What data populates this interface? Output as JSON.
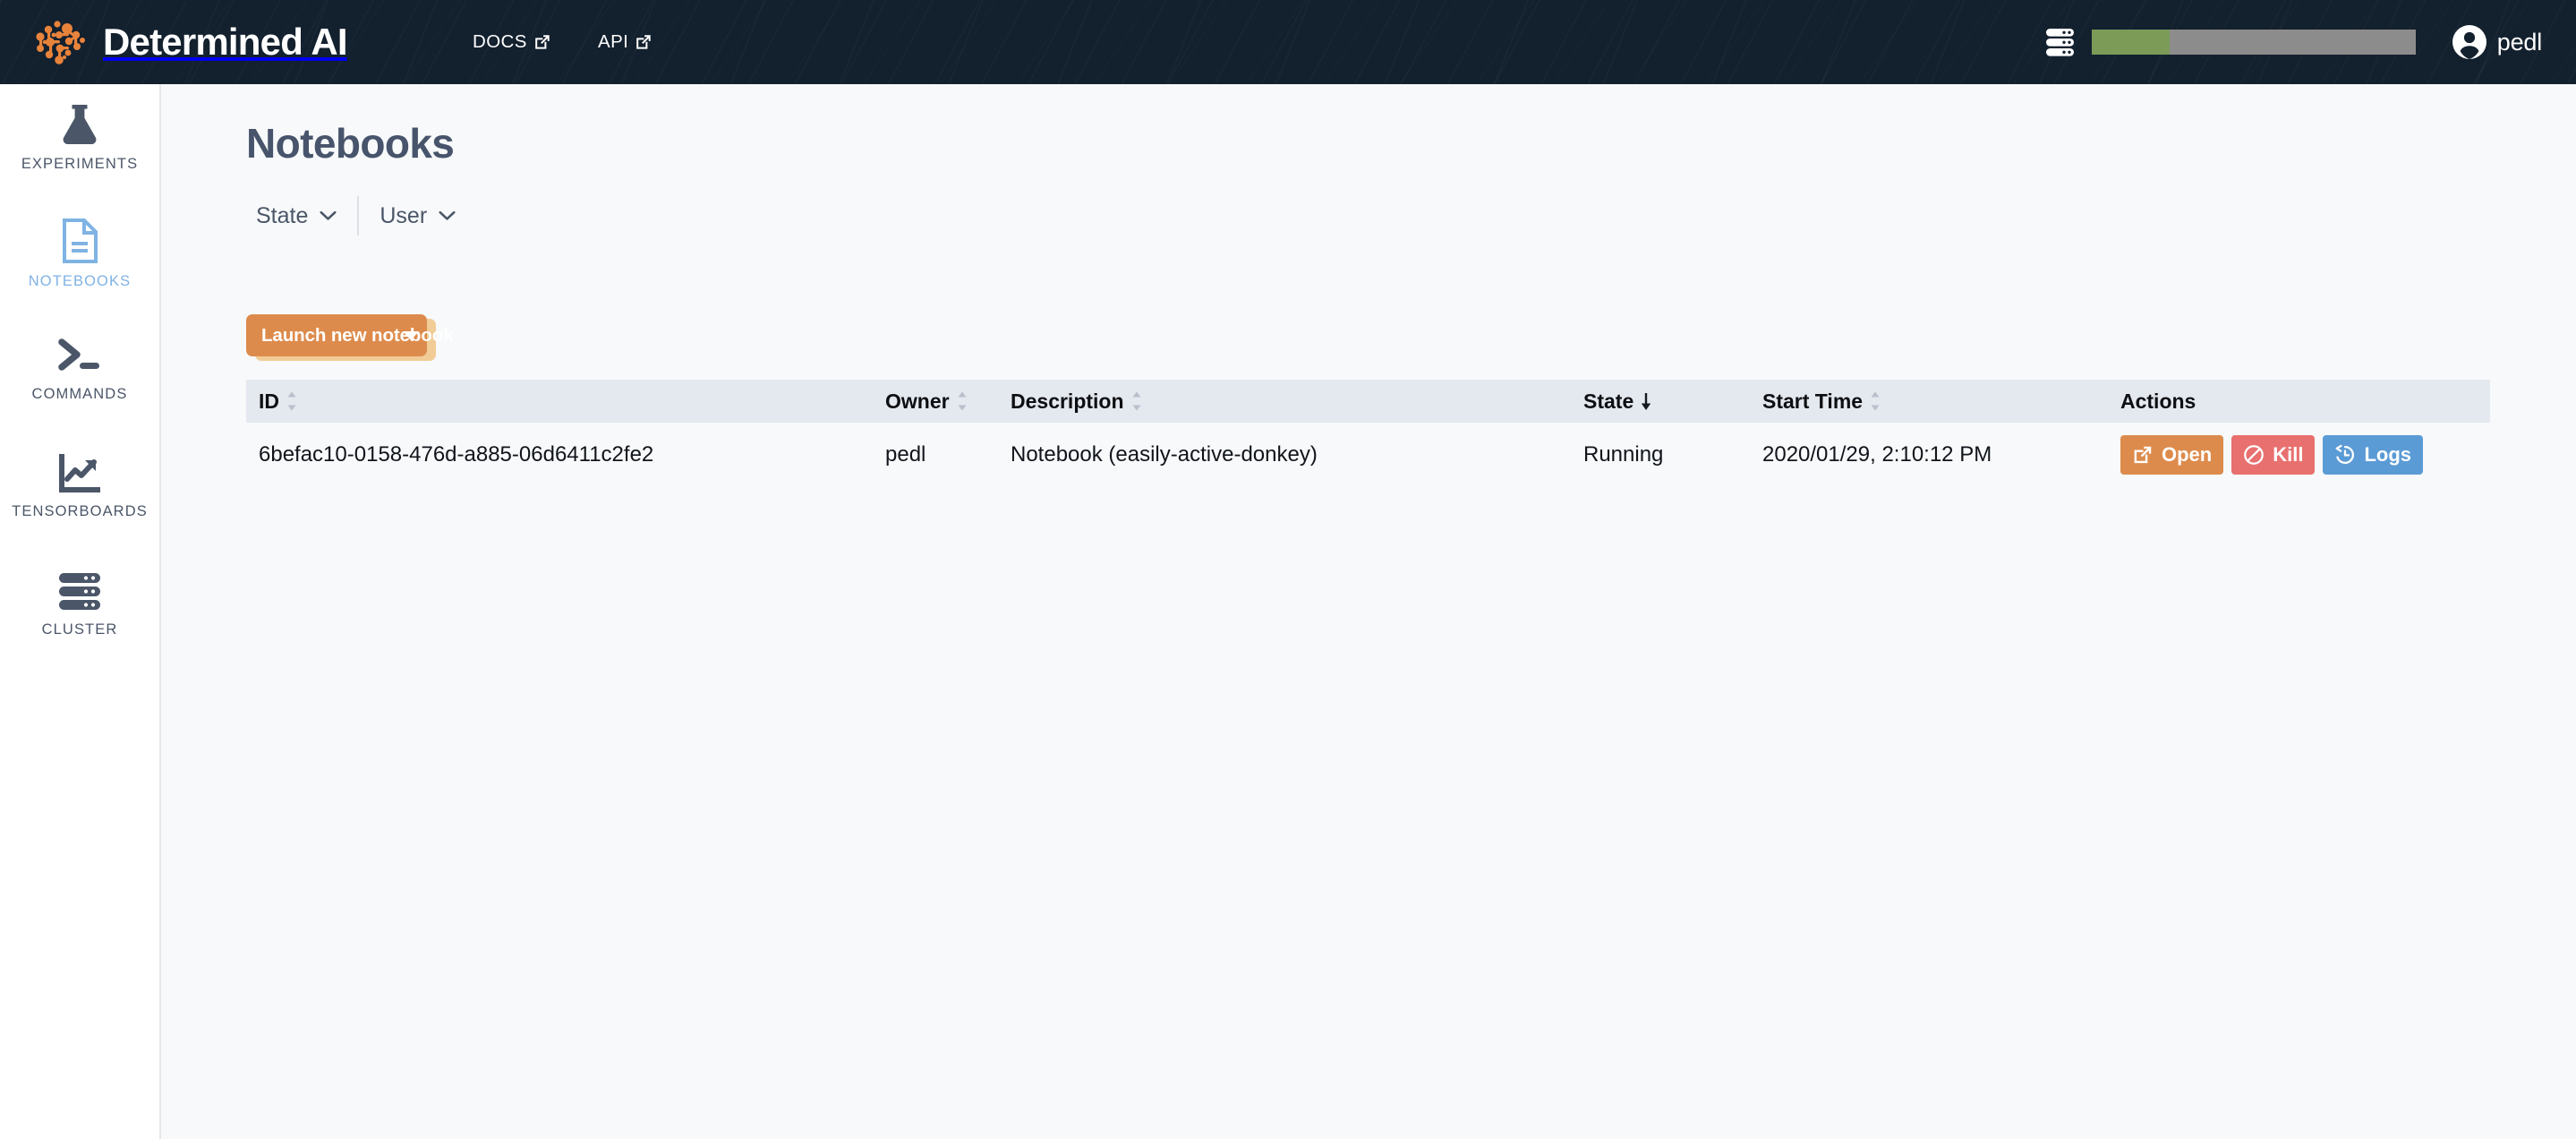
{
  "topnav": {
    "brand_title": "Determined AI",
    "brand_logo_icon": "determined-brain-logo",
    "links": [
      {
        "label": "DOCS",
        "icon": "external-link-icon"
      },
      {
        "label": "API",
        "icon": "external-link-icon"
      }
    ],
    "cluster_icon": "server-stack-icon",
    "cluster_progress": {
      "percent": 24,
      "fill_color": "#7B9B57",
      "track_color": "#8C8C8C"
    },
    "user": {
      "name": "pedl",
      "avatar_icon": "user-circle-icon"
    },
    "background_color": "#13202E"
  },
  "sidebar": {
    "items": [
      {
        "label": "EXPERIMENTS",
        "icon": "flask-icon",
        "active": false
      },
      {
        "label": "NOTEBOOKS",
        "icon": "document-icon",
        "active": true
      },
      {
        "label": "COMMANDS",
        "icon": "terminal-icon",
        "active": false
      },
      {
        "label": "TENSORBOARDS",
        "icon": "chart-line-icon",
        "active": false
      },
      {
        "label": "CLUSTER",
        "icon": "server-stack-icon",
        "active": false
      }
    ],
    "active_color": "#7FB3E4",
    "inactive_color": "#4B5668"
  },
  "main": {
    "page_title": "Notebooks",
    "filters": [
      {
        "label": "State",
        "icon": "chevron-down-icon"
      },
      {
        "label": "User",
        "icon": "chevron-down-icon"
      }
    ],
    "launch_button": {
      "label": "Launch new notebook",
      "dropdown_icon": "caret-down-icon",
      "color": "#DD8B4C",
      "shadow_color": "#F1CC96"
    },
    "table": {
      "columns": [
        {
          "label": "ID",
          "sort": "none"
        },
        {
          "label": "Owner",
          "sort": "none"
        },
        {
          "label": "Description",
          "sort": "none"
        },
        {
          "label": "State",
          "sort": "desc"
        },
        {
          "label": "Start Time",
          "sort": "none"
        },
        {
          "label": "Actions",
          "sort": null
        }
      ],
      "rows": [
        {
          "id": "6befac10-0158-476d-a885-06d6411c2fe2",
          "owner": "pedl",
          "description": "Notebook (easily-active-donkey)",
          "state": "Running",
          "state_color": "#5BBE7F",
          "start_time": "2020/01/29, 2:10:12 PM",
          "actions": [
            {
              "label": "Open",
              "icon": "external-link-icon",
              "color": "#DD8B4C"
            },
            {
              "label": "Kill",
              "icon": "ban-icon",
              "color": "#E8706E"
            },
            {
              "label": "Logs",
              "icon": "history-clock-icon",
              "color": "#5B9BD5"
            }
          ]
        }
      ],
      "header_bg": "#E4E8EF"
    }
  }
}
